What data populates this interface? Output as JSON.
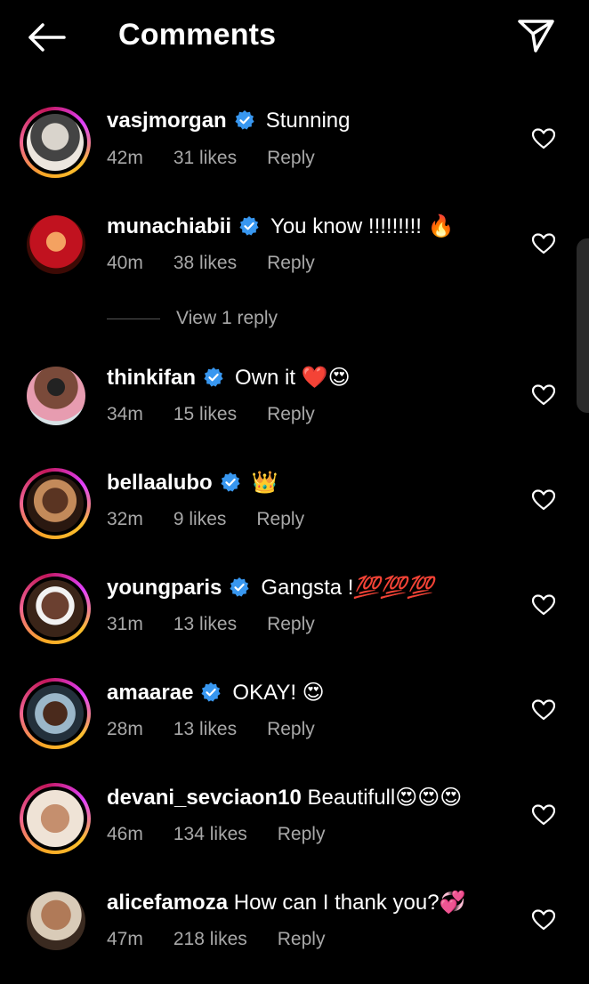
{
  "header": {
    "title": "Comments"
  },
  "comments": [
    {
      "user": "vasjmorgan",
      "text": "Stunning",
      "time": "42m",
      "likes": "31 likes",
      "reply": "Reply",
      "verified": true
    },
    {
      "user": "munachiabii",
      "text": "You know !!!!!!!!!",
      "emoji": "🔥",
      "time": "40m",
      "likes": "38 likes",
      "reply": "Reply",
      "verified": true
    },
    {
      "user": "thinkifan",
      "text": "Own it",
      "emoji": "❤️😍",
      "time": "34m",
      "likes": "15 likes",
      "reply": "Reply",
      "verified": true
    },
    {
      "user": "bellaalubo",
      "text": "",
      "emoji": "👑",
      "time": "32m",
      "likes": "9 likes",
      "reply": "Reply",
      "verified": true
    },
    {
      "user": "youngparis",
      "text": "Gangsta !",
      "emoji": "💯💯💯",
      "time": "31m",
      "likes": "13 likes",
      "reply": "Reply",
      "verified": true
    },
    {
      "user": "amaarae",
      "text": "OKAY!",
      "emoji": "😍",
      "time": "28m",
      "likes": "13 likes",
      "reply": "Reply",
      "verified": true
    },
    {
      "user": "devani_sevciaon10",
      "text": "Beautifull",
      "emoji": "😍😍😍",
      "time": "46m",
      "likes": "134 likes",
      "reply": "Reply",
      "verified": false
    },
    {
      "user": "alicefamoza",
      "text": "How can I thank you?",
      "emoji": "💞",
      "time": "47m",
      "likes": "218 likes",
      "reply": "Reply",
      "verified": false
    }
  ],
  "view_replies": "View 1 reply",
  "colors": {
    "verified": "#3897f0",
    "muted": "#a8a8a8",
    "background": "#000000"
  }
}
